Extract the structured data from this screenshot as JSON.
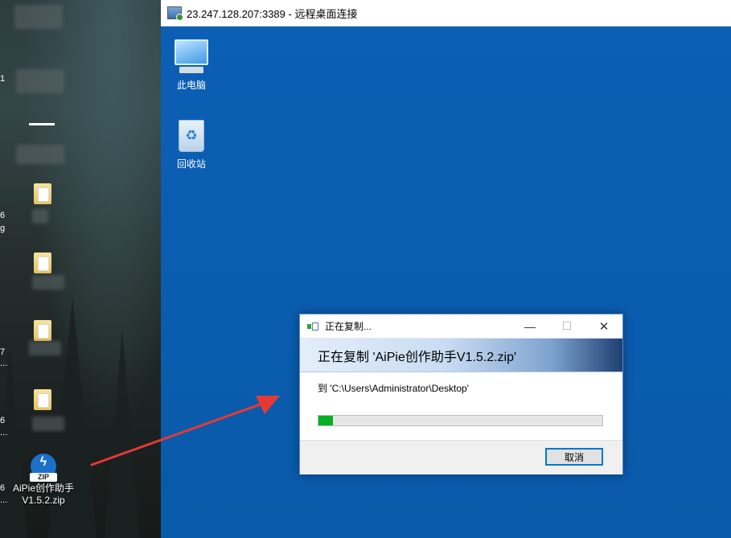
{
  "remote_window": {
    "title": "23.247.128.207:3389 - 远程桌面连接"
  },
  "remote_desktop": {
    "icons": [
      {
        "label": "此电脑",
        "icon": "this-pc-icon"
      },
      {
        "label": "回收站",
        "icon": "recycle-bin-icon"
      }
    ]
  },
  "local_desktop": {
    "zip_file": {
      "tag": "ZIP",
      "label": "AiPie创作助手V1.5.2.zip"
    },
    "edge_fragments": [
      "1",
      "6",
      "g",
      "7",
      "...",
      "6",
      "...",
      "6",
      "..."
    ]
  },
  "copy_dialog": {
    "title": "正在复制...",
    "heading": "正在复制 'AiPie创作助手V1.5.2.zip'",
    "destination": "到 'C:\\Users\\Administrator\\Desktop'",
    "progress_percent": 5,
    "cancel_label": "取消",
    "minimize_glyph": "—",
    "maximize_glyph": "☐",
    "close_glyph": "✕"
  },
  "colors": {
    "remote_background": "#0a5cb0",
    "progress": "#06b025",
    "annotation_arrow": "#e53935",
    "focus_border": "#0078d7"
  }
}
